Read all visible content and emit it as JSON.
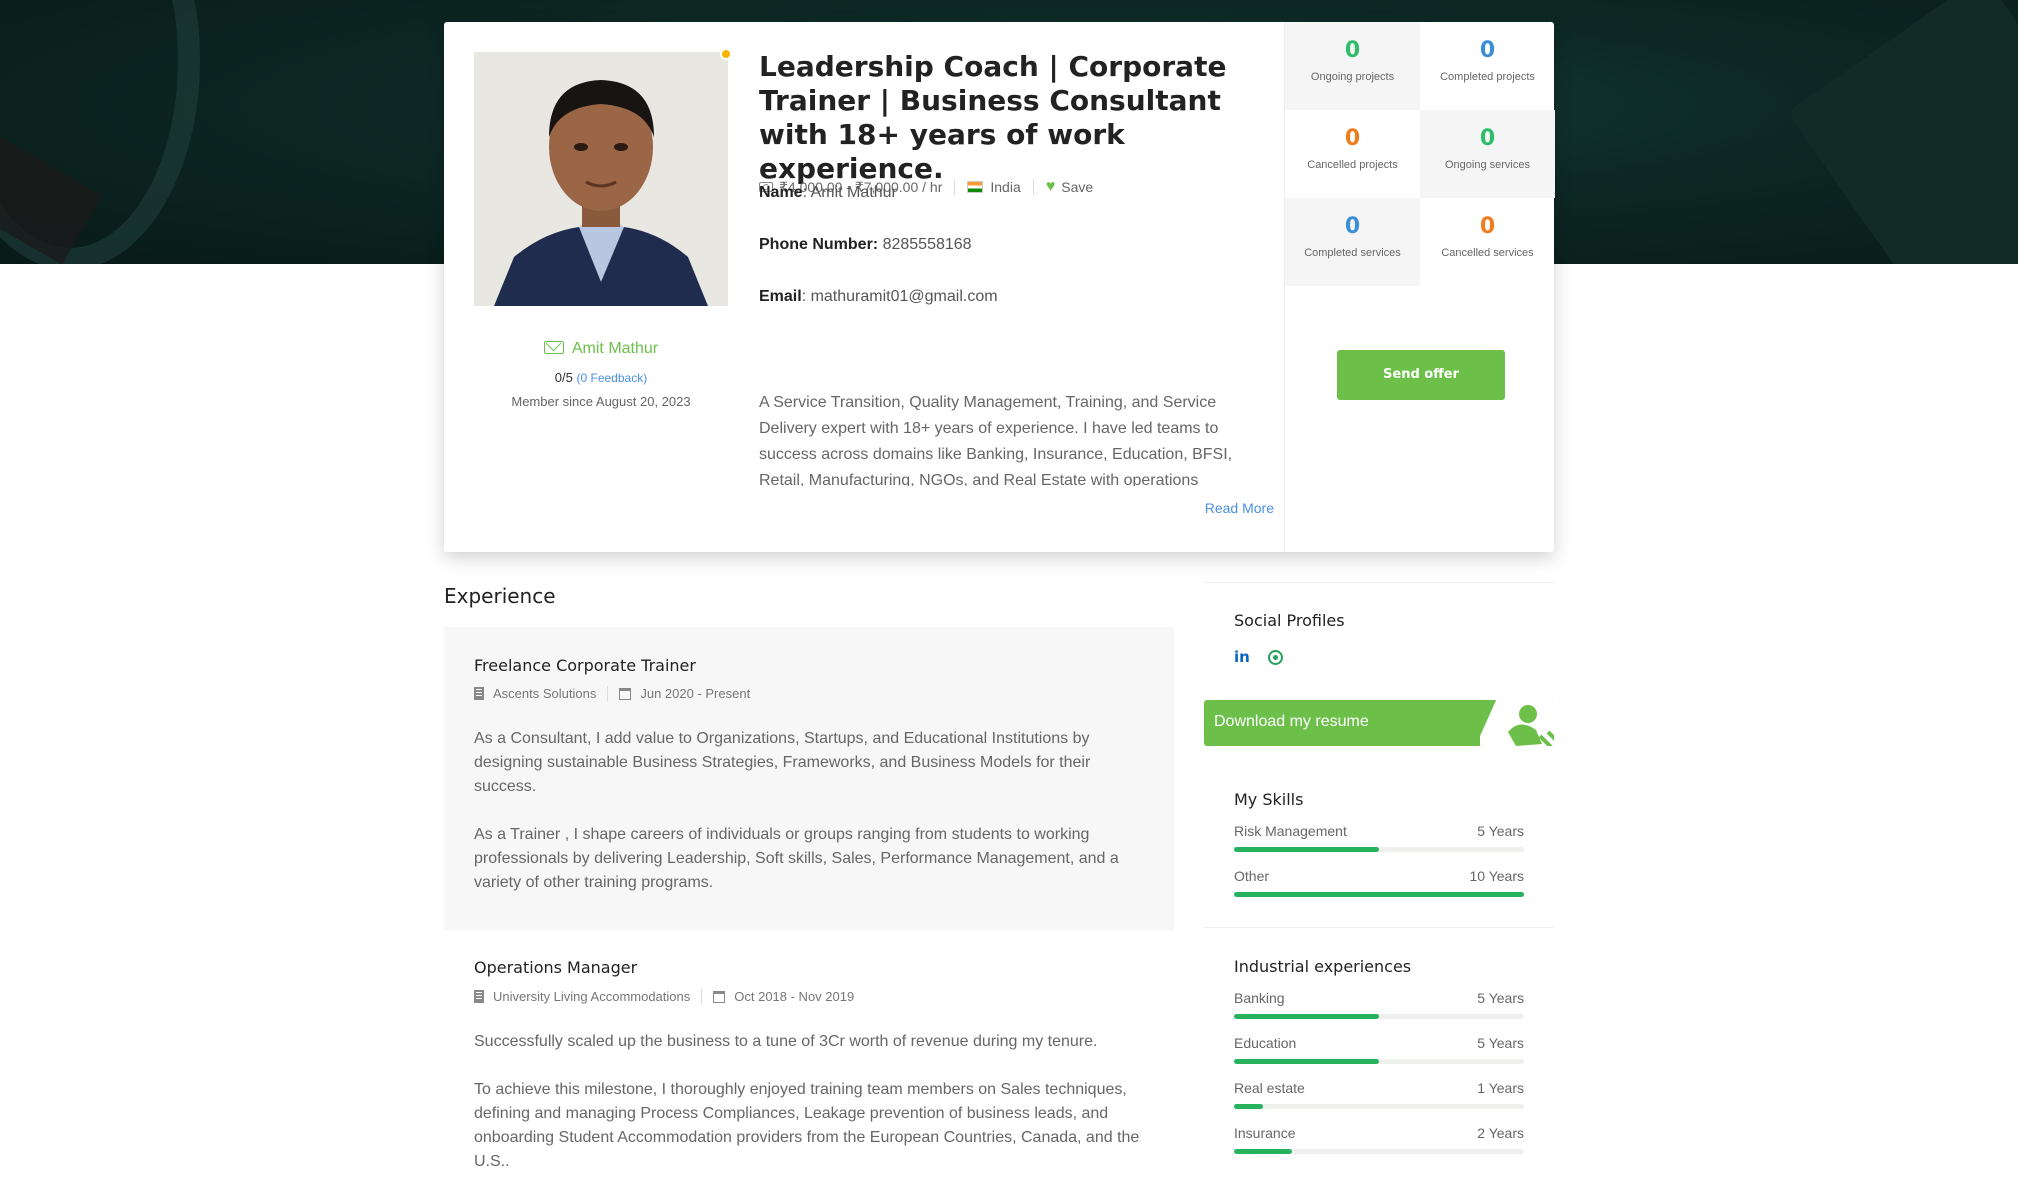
{
  "profile": {
    "headline": "Leadership Coach | Corporate Trainer | Business Consultant with 18+ years of work experience.",
    "rate": "₹4,000.00 - ₹7,000.00 / hr",
    "country": "India",
    "save_label": "Save",
    "name_label": "Name",
    "name_value": ": Amit Mathur",
    "phone_label": "Phone Number:",
    "phone_value": " 8285558168",
    "email_label": "Email",
    "email_value": ": mathuramit01@gmail.com",
    "bio": "A Service Transition, Quality Management, Training, and Service Delivery expert with 18+ years of experience. I have led teams to success across domains like Banking, Insurance, Education, BFSI, Retail, Manufacturing, NGOs, and Real Estate with operations",
    "read_more": "Read More",
    "display_name": "Amit Mathur",
    "rating": "0/5",
    "feedback": "(0 Feedback)",
    "member_since": "Member since August 20, 2023"
  },
  "stats": [
    {
      "value": "0",
      "label": "Ongoing projects",
      "color": "#2ebd6b"
    },
    {
      "value": "0",
      "label": "Completed projects",
      "color": "#3b8fd6"
    },
    {
      "value": "0",
      "label": "Cancelled projects",
      "color": "#f07c1e"
    },
    {
      "value": "0",
      "label": "Ongoing services",
      "color": "#2ebd6b"
    },
    {
      "value": "0",
      "label": "Completed services",
      "color": "#3b8fd6"
    },
    {
      "value": "0",
      "label": "Cancelled services",
      "color": "#f07c1e"
    }
  ],
  "send_offer_label": "Send offer",
  "experience": {
    "title": "Experience",
    "jobs": [
      {
        "title": "Freelance Corporate Trainer",
        "company": "Ascents Solutions",
        "period": "Jun 2020 - Present",
        "para1": "As a Consultant, I add value to Organizations, Startups, and Educational Institutions by designing sustainable Business Strategies, Frameworks, and Business Models for their success.",
        "para2": "As a Trainer , I shape careers of individuals or groups ranging from students to working professionals by delivering Leadership, Soft skills, Sales, Performance Management, and a variety of other training programs."
      },
      {
        "title": "Operations Manager",
        "company": "University Living Accommodations",
        "period": "Oct 2018 - Nov 2019",
        "para1": "Successfully scaled up the business to a tune of 3Cr worth of revenue during my tenure.",
        "para2": "To achieve this milestone, I thoroughly enjoyed training team members on Sales techniques, defining and managing Process Compliances, Leakage prevention of business leads, and onboarding Student Accommodation providers from the European Countries, Canada, and the U.S.."
      }
    ]
  },
  "sidebar": {
    "social_title": "Social Profiles",
    "linkedin_glyph": "in",
    "resume_label": "Download my resume",
    "skills_title": "My Skills",
    "skills": [
      {
        "name": "Risk Management",
        "years": "5 Years",
        "level": 0.5
      },
      {
        "name": "Other",
        "years": "10 Years",
        "level": 1.0
      }
    ],
    "industry_title": "Industrial experiences",
    "industries": [
      {
        "name": "Banking",
        "years": "5 Years",
        "level": 0.5
      },
      {
        "name": "Education",
        "years": "5 Years",
        "level": 0.5
      },
      {
        "name": "Real estate",
        "years": "1 Years",
        "level": 0.1
      },
      {
        "name": "Insurance",
        "years": "2 Years",
        "level": 0.2
      }
    ]
  },
  "colors": {
    "accent": "#6cc04a",
    "link": "#4a90e2",
    "bar": "#27b35d"
  }
}
